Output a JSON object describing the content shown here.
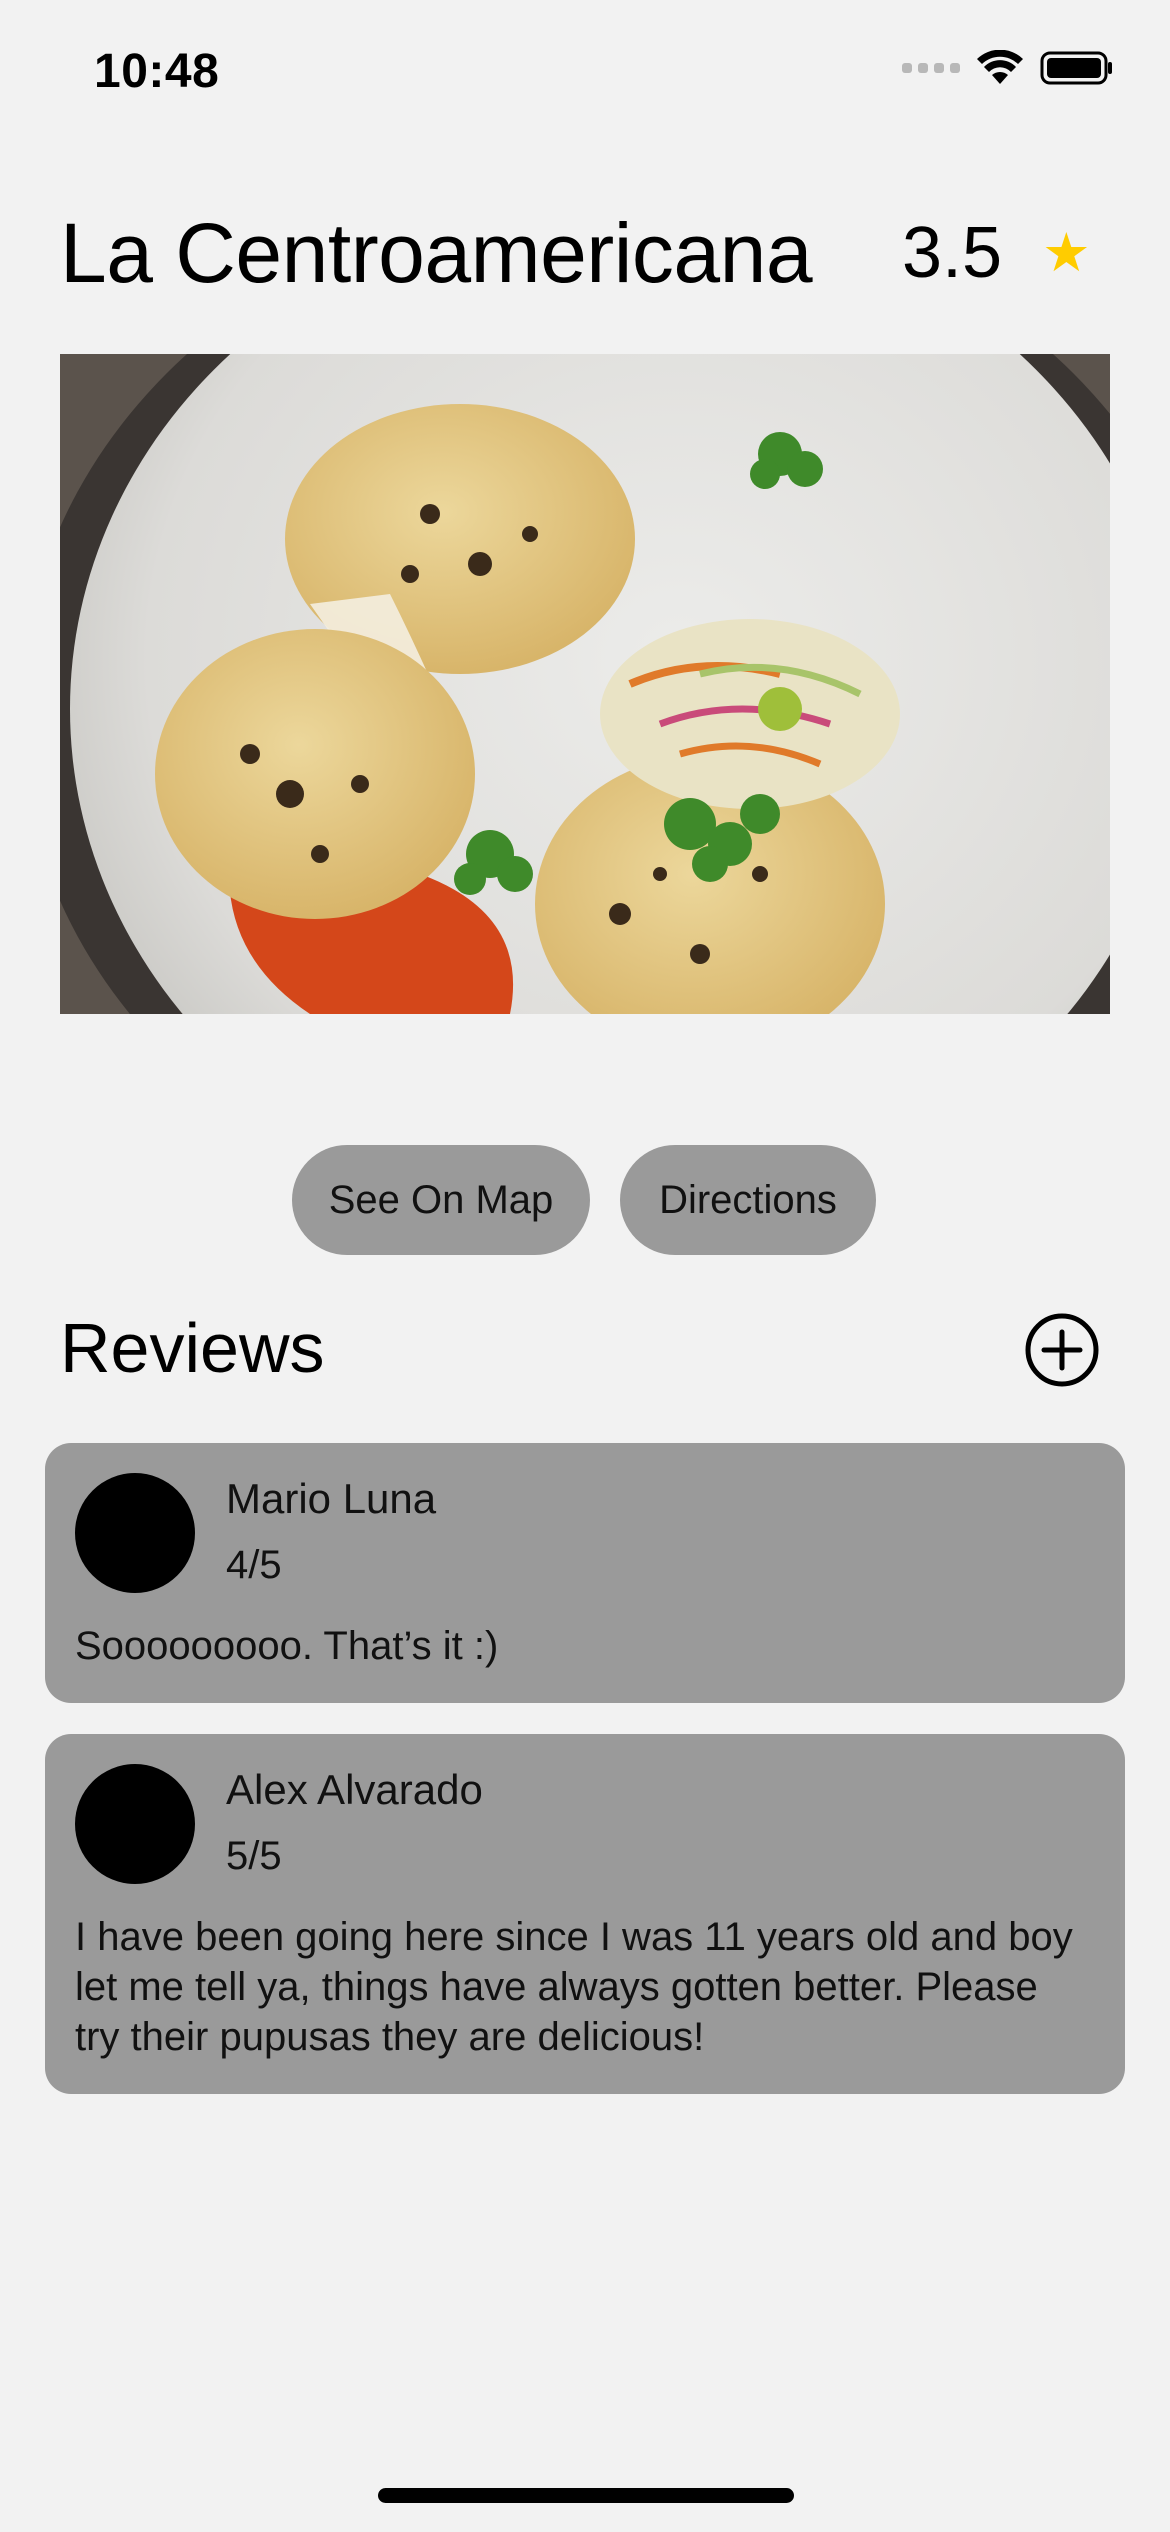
{
  "status_bar": {
    "time": "10:48"
  },
  "restaurant": {
    "name": "La Centroamericana",
    "rating": "3.5",
    "rating_icon": "star-icon",
    "rating_color": "#ffcc00",
    "image_description_icon": "pupusas-photo"
  },
  "actions": {
    "see_on_map": "See On Map",
    "directions": "Directions"
  },
  "reviews": {
    "title": "Reviews",
    "add_icon": "plus-circle-icon",
    "items": [
      {
        "name": "Mario Luna",
        "score": "4/5",
        "text": "Sooooooooo. That’s it :)"
      },
      {
        "name": "Alex Alvarado",
        "score": "5/5",
        "text": "I have been going here since I was 11 years old and boy let me tell ya, things have always gotten better. Please try their pupusas they are delicious!"
      }
    ]
  },
  "colors": {
    "background": "#f2f2f2",
    "card": "#9a9a9a",
    "button": "#9a9a9a",
    "star": "#ffcc00"
  }
}
